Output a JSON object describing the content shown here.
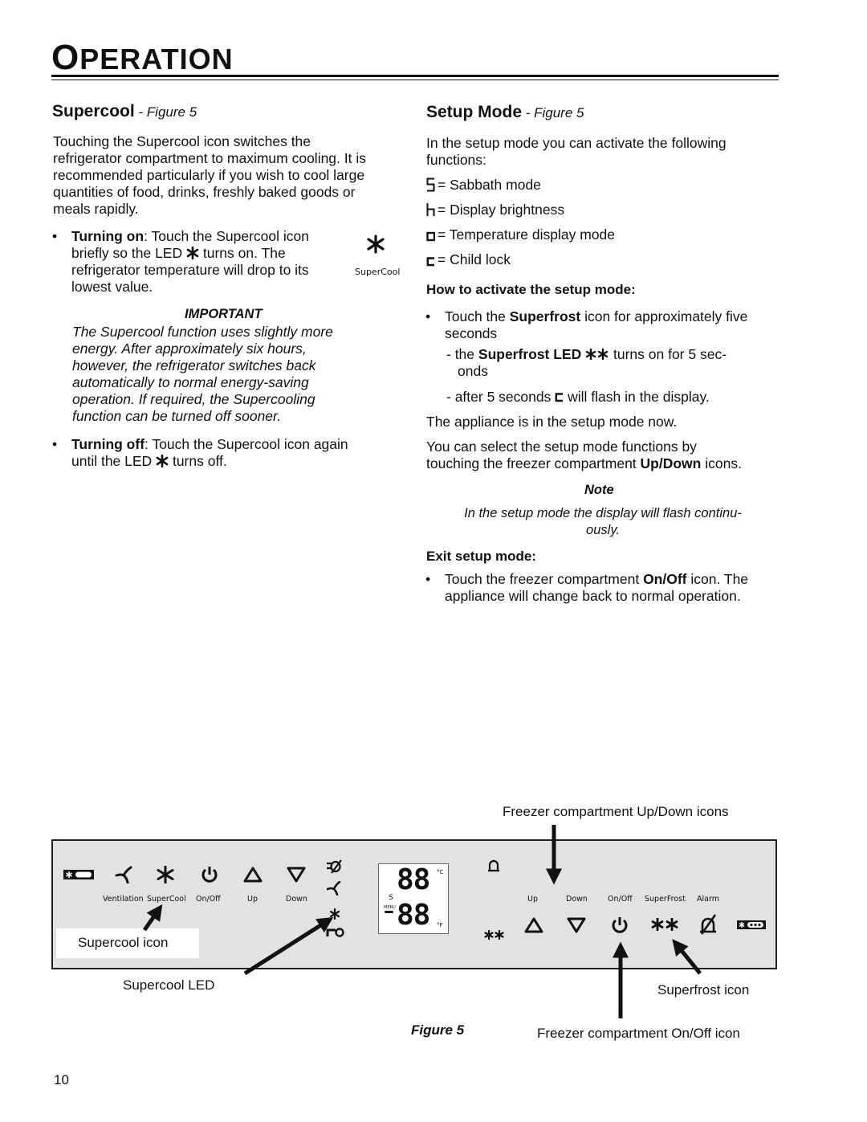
{
  "header": {
    "title_first": "O",
    "title_rest": "PERATION"
  },
  "supercool": {
    "heading": "Supercool",
    "heading_fig": " - Figure 5",
    "intro": [
      "Touching the Supercool icon switches the",
      "refrigerator compartment to maximum cooling. It is",
      "recommended particularly if you wish to cool large",
      "quantities of food, drinks, freshly baked goods or",
      "meals rapidly."
    ],
    "turning_on": {
      "label": "Turning on",
      "line1": ": Touch the Supercool icon",
      "line2a": "briefly so the LED",
      "line2b": "turns on. The",
      "line3": "refrigerator temperature will drop to its",
      "line4": "lowest value."
    },
    "side_icon_label": "SuperCool",
    "important": {
      "title": "IMPORTANT",
      "lines": [
        "The Supercool function uses slightly more",
        "energy. After approximately six hours,",
        "however, the refrigerator switches back",
        "automatically to normal energy-saving",
        "operation. If required, the Supercooling",
        "function can be turned off sooner."
      ]
    },
    "turning_off": {
      "label": "Turning off",
      "line1": ": Touch the Supercool icon again",
      "line2a": "until the LED",
      "line2b": "turns off."
    }
  },
  "setup": {
    "heading": "Setup Mode",
    "heading_fig": " - Figure 5",
    "intro": [
      "In the setup mode you can activate the following",
      "functions:"
    ],
    "functions": [
      {
        "symbol": "S",
        "label": "= Sabbath mode"
      },
      {
        "symbol": "h",
        "label": "= Display brightness"
      },
      {
        "symbol": "o",
        "label": "= Temperature display mode"
      },
      {
        "symbol": "c",
        "label": "= Child lock"
      }
    ],
    "activate_heading": "How to activate the setup mode:",
    "activate": {
      "bullet_a": "Touch the ",
      "bullet_b": "Superfrost",
      "bullet_c": " icon for approximately five",
      "bullet_d": "seconds",
      "sub1_a": "-  the ",
      "sub1_b": "Superfrost LED",
      "sub1_c": " turns on for 5 sec-",
      "sub1_d": "onds",
      "sub2_a": "-  after 5 seconds",
      "sub2_b": "will flash in the display."
    },
    "in_mode": "The appliance is in the setup mode now.",
    "select_a": "You can select the setup mode functions by",
    "select_b": "touching the freezer compartment ",
    "select_c": "Up/Down",
    "select_d": " icons.",
    "note_title": "Note",
    "note_lines": [
      "In the setup mode the display will flash continu-",
      "ously."
    ],
    "exit_heading": "Exit setup mode:",
    "exit_a": "Touch the freezer compartment ",
    "exit_b": "On/Off",
    "exit_c": " icon. The",
    "exit_d": "appliance will change back to normal operation."
  },
  "figure": {
    "callout_updown": "Freezer compartment Up/Down icons",
    "callout_supercool_icon": "Supercool icon",
    "callout_supercool_led": "Supercool LED",
    "callout_superfrost_icon": "Superfrost icon",
    "callout_onoff": "Freezer compartment On/Off icon",
    "caption": "Figure 5",
    "fridge_labels": [
      "Ventilation",
      "SuperCool",
      "On/Off",
      "Up",
      "Down"
    ],
    "freezer_labels": [
      "Up",
      "Down",
      "On/Off",
      "SuperFrost",
      "Alarm"
    ],
    "display": {
      "digits_top": "88",
      "digits_bottom": "88",
      "unit_c": "°C",
      "unit_f": "°F",
      "s_label": "S",
      "menu_label": "MENU"
    }
  },
  "footer": {
    "page_number": "10"
  }
}
